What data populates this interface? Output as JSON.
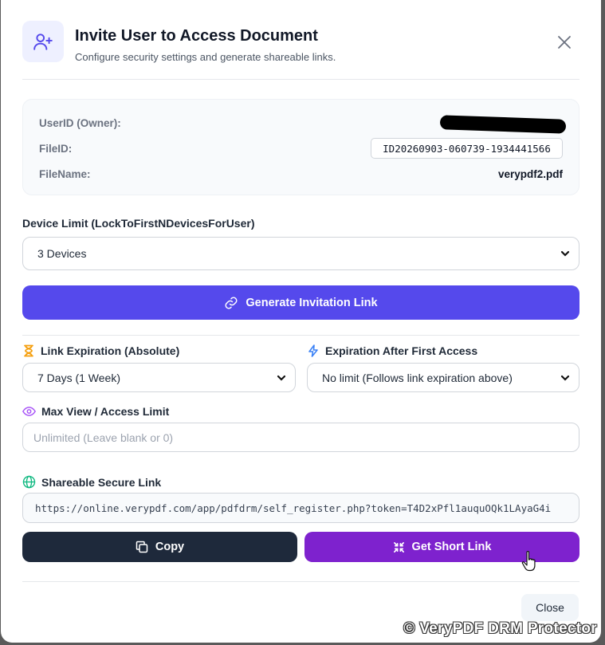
{
  "header": {
    "title": "Invite User to Access Document",
    "subtitle": "Configure security settings and generate shareable links.",
    "avatar_icon": "user-plus-icon",
    "close_icon": "close-icon"
  },
  "info": {
    "owner_label": "UserID (Owner):",
    "file_id_label": "FileID:",
    "file_id_value": "ID20260903-060739-1934441566",
    "file_name_label": "FileName:",
    "file_name_value": "verypdf2.pdf"
  },
  "device_limit": {
    "label": "Device Limit (LockToFirstNDevicesForUser)",
    "selected": "3 Devices"
  },
  "generate_button": {
    "label": "Generate Invitation Link",
    "icon": "link-icon"
  },
  "link_expiration": {
    "label": "Link Expiration (Absolute)",
    "icon": "hourglass-icon",
    "selected": "7 Days (1 Week)"
  },
  "expiration_after_first": {
    "label": "Expiration After First Access",
    "icon": "lightning-icon",
    "selected": "No limit (Follows link expiration above)"
  },
  "max_view": {
    "label": "Max View / Access Limit",
    "icon": "eye-icon",
    "placeholder": "Unlimited (Leave blank or 0)"
  },
  "shareable": {
    "label": "Shareable Secure Link",
    "icon": "globe-icon",
    "url": "https://online.verypdf.com/app/pdfdrm/self_register.php?token=T4D2xPfl1auquOQk1LAyaG4i"
  },
  "copy_button": {
    "label": "Copy",
    "icon": "copy-icon"
  },
  "short_link_button": {
    "label": "Get Short Link",
    "icon": "compress-icon"
  },
  "close_button": {
    "label": "Close"
  },
  "watermark": "© VeryPDF DRM Protector",
  "colors": {
    "primary": "#5549ec",
    "purple": "#7e22ce",
    "dark": "#1e293b",
    "hourglass": "#f59e0b",
    "lightning": "#3b82f6",
    "eye": "#a855f7",
    "globe": "#10b981"
  }
}
